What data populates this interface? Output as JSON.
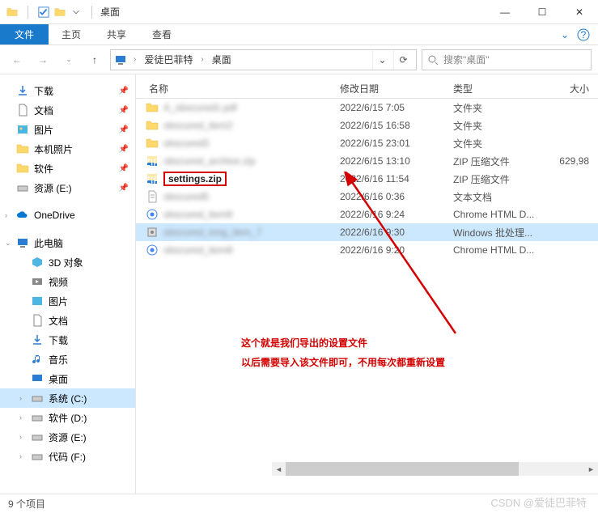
{
  "window": {
    "title": "桌面",
    "controls": {
      "min": "—",
      "max": "☐",
      "close": "✕"
    }
  },
  "ribbon": {
    "file": "文件",
    "home": "主页",
    "share": "共享",
    "view": "查看"
  },
  "address": {
    "crumb1": "爱徒巴菲特",
    "crumb2": "桌面",
    "search_placeholder": "搜索\"桌面\""
  },
  "columns": {
    "name": "名称",
    "date": "修改日期",
    "type": "类型",
    "size": "大小"
  },
  "sidebar": {
    "downloads": "下载",
    "documents": "文档",
    "pictures": "图片",
    "local_photos": "本机照片",
    "software": "软件",
    "resources": "资源 (E:)",
    "onedrive": "OneDrive",
    "this_pc": "此电脑",
    "objects3d": "3D 对象",
    "videos": "视频",
    "pictures2": "图片",
    "documents2": "文档",
    "downloads2": "下载",
    "music": "音乐",
    "desktop": "桌面",
    "system_c": "系统 (C:)",
    "soft_d": "软件 (D:)",
    "res_e": "资源 (E:)",
    "code_f": "代码 (F:)"
  },
  "files": [
    {
      "name_blur": "A_obscured1.pdf",
      "date": "2022/6/15 7:05",
      "type": "文件夹",
      "size": "",
      "icon": "folder"
    },
    {
      "name_blur": "obscured_item2",
      "date": "2022/6/15 16:58",
      "type": "文件夹",
      "size": "",
      "icon": "folder"
    },
    {
      "name_blur": "obscured3",
      "date": "2022/6/15 23:01",
      "type": "文件夹",
      "size": "",
      "icon": "folder"
    },
    {
      "name_blur": "obscured_archive.zip",
      "date": "2022/6/15 13:10",
      "type": "ZIP 压缩文件",
      "size": "629,98",
      "icon": "zip"
    },
    {
      "name": "settings.zip",
      "date": "2022/6/16 11:54",
      "type": "ZIP 压缩文件",
      "size": "",
      "icon": "zip",
      "boxed": true
    },
    {
      "name_blur": "obscured5",
      "date": "2022/6/16 0:36",
      "type": "文本文档",
      "size": "",
      "icon": "txt"
    },
    {
      "name_blur": "obscured_item6",
      "date": "2022/6/16 9:24",
      "type": "Chrome HTML D...",
      "size": "",
      "icon": "html"
    },
    {
      "name_blur": "obscured_long_item_7",
      "date": "2022/6/16 9:30",
      "type": "Windows 批处理...",
      "size": "",
      "icon": "bat",
      "hl": true
    },
    {
      "name_blur": "obscured_item8",
      "date": "2022/6/16 9:20",
      "type": "Chrome HTML D...",
      "size": "",
      "icon": "html"
    }
  ],
  "annotation": {
    "line1": "这个就是我们导出的设置文件",
    "line2": "以后需要导入该文件即可，不用每次都重新设置"
  },
  "status": {
    "items": "9 个项目"
  },
  "watermark": "CSDN @爱徒巴菲特"
}
